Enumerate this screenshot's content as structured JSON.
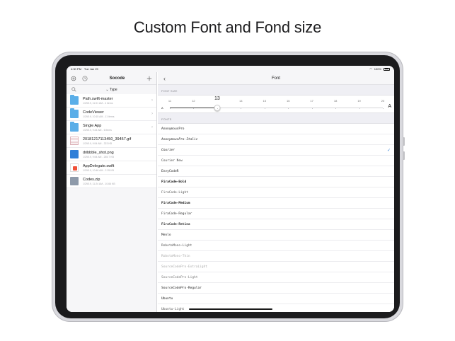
{
  "headline": "Custom Font and Fond size",
  "status_bar": {
    "time": "4:30 PM",
    "date": "Tue Jan 29",
    "battery": "100%"
  },
  "sidebar": {
    "title": "Socode",
    "settings_icon": "gear-icon",
    "recent_icon": "clock-icon",
    "add_icon": "plus-icon",
    "search_icon": "search-icon",
    "sort_label": "Type",
    "files": [
      {
        "name": "Path.swift-master",
        "meta": "1/29/19, 11:01 AM - 4 items",
        "kind": "folder"
      },
      {
        "name": "CodeViewer",
        "meta": "1/29/19, 10:15 AM - 11 items",
        "kind": "folder"
      },
      {
        "name": "Single App",
        "meta": "1/29/19, 9:44 AM - 6 items",
        "kind": "folder"
      },
      {
        "name": "20181217113450_39457.gif",
        "meta": "1/29/19, 9:54 AM - 323 KB",
        "kind": "gif"
      },
      {
        "name": "dribbble_shot.png",
        "meta": "1/29/19, 9:54 AM - 265.7 KB",
        "kind": "png"
      },
      {
        "name": "AppDelegate.swift",
        "meta": "1/29/19, 10:46 AM - 2.25 KB",
        "kind": "swift"
      },
      {
        "name": "Codes.zip",
        "meta": "1/29/19, 11:24 AM - 10.66 KB",
        "kind": "zip"
      }
    ]
  },
  "detail": {
    "title": "Font",
    "back_icon": "chevron-left-icon",
    "font_size_header": "FONT SIZE",
    "size_ticks": [
      "11",
      "12",
      "13",
      "14",
      "15",
      "16",
      "17",
      "18",
      "19",
      "20"
    ],
    "current_size": 13,
    "size_min": 11,
    "size_max": 20,
    "small_a": "A",
    "large_a": "A",
    "fonts_header": "FONTS",
    "selected_font": "Courier",
    "check_glyph": "✓",
    "fonts": [
      {
        "label": "AnonymousPro",
        "style": "normal",
        "color": "#222222"
      },
      {
        "label": "AnonymousPro-Italic",
        "style": "italic",
        "color": "#222222"
      },
      {
        "label": "Courier",
        "style": "italic",
        "color": "#222222"
      },
      {
        "label": "Courier New",
        "style": "normal",
        "color": "#444444"
      },
      {
        "label": "EnvyCodeR",
        "style": "normal",
        "color": "#222222"
      },
      {
        "label": "FiraCode-Bold",
        "style": "bold",
        "color": "#111111"
      },
      {
        "label": "FiraCode-Light",
        "style": "normal",
        "color": "#555555"
      },
      {
        "label": "FiraCode-Medium",
        "style": "bold",
        "color": "#222222"
      },
      {
        "label": "FiraCode-Regular",
        "style": "normal",
        "color": "#333333"
      },
      {
        "label": "FiraCode-Retina",
        "style": "bold",
        "color": "#333333"
      },
      {
        "label": "Menlo",
        "style": "normal",
        "color": "#222222"
      },
      {
        "label": "RobotoMono-Light",
        "style": "normal",
        "color": "#555555"
      },
      {
        "label": "RobotoMono-Thin",
        "style": "normal",
        "color": "#aaaaaa"
      },
      {
        "label": "SourceCodePro-ExtraLight",
        "style": "normal",
        "color": "#aaaaaa"
      },
      {
        "label": "SourceCodePro-Light",
        "style": "normal",
        "color": "#777777"
      },
      {
        "label": "SourceCodePro-Regular",
        "style": "normal",
        "color": "#222222"
      },
      {
        "label": "Ubuntu",
        "style": "normal",
        "color": "#222222"
      },
      {
        "label": "Ubuntu-Light",
        "style": "normal",
        "color": "#555555"
      }
    ]
  }
}
